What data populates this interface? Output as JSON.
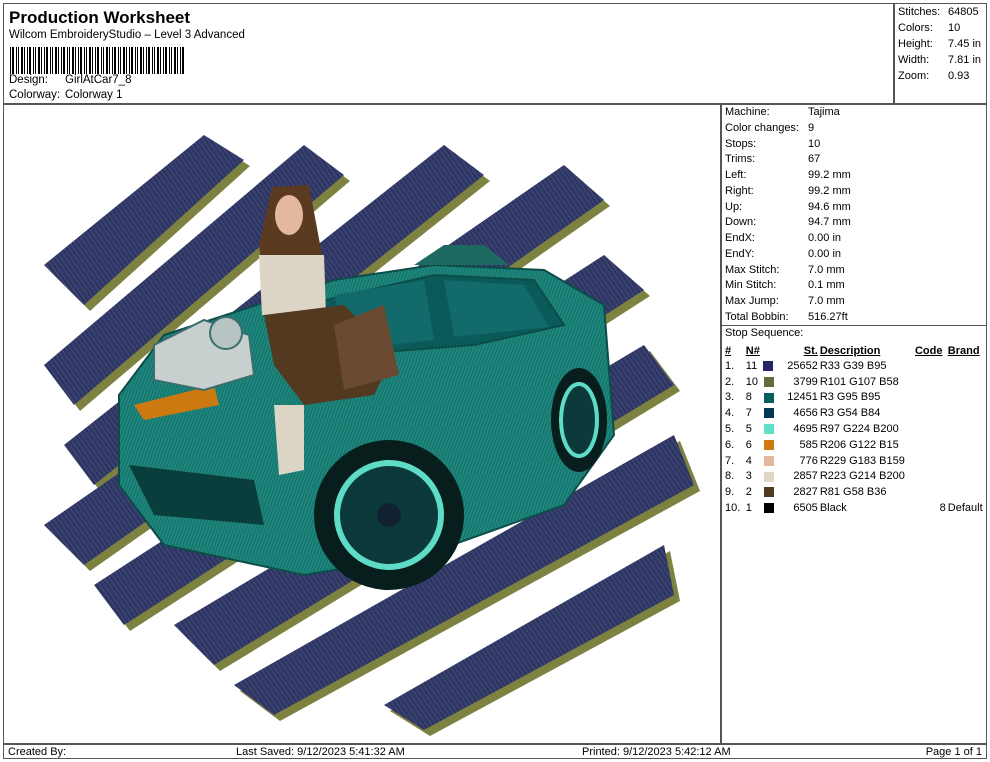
{
  "header": {
    "title": "Production Worksheet",
    "software": "Wilcom EmbroideryStudio – Level 3 Advanced",
    "design_label": "Design:",
    "design_value": "GirlAtCar7_8",
    "colorway_label": "Colorway:",
    "colorway_value": "Colorway 1"
  },
  "summary": [
    {
      "label": "Stitches:",
      "value": "64805"
    },
    {
      "label": "Colors:",
      "value": "10"
    },
    {
      "label": "Height:",
      "value": "7.45 in"
    },
    {
      "label": "Width:",
      "value": "7.81 in"
    },
    {
      "label": "Zoom:",
      "value": "0.93"
    }
  ],
  "details": [
    {
      "label": "Machine:",
      "value": "Tajima"
    },
    {
      "label": "Color changes:",
      "value": "9"
    },
    {
      "label": "Stops:",
      "value": "10"
    },
    {
      "label": "Trims:",
      "value": "67"
    },
    {
      "label": "Left:",
      "value": "99.2 mm"
    },
    {
      "label": "Right:",
      "value": "99.2 mm"
    },
    {
      "label": "Up:",
      "value": "94.6 mm"
    },
    {
      "label": "Down:",
      "value": "94.7 mm"
    },
    {
      "label": "EndX:",
      "value": "0.00 in"
    },
    {
      "label": "EndY:",
      "value": "0.00 in"
    },
    {
      "label": "Max Stitch:",
      "value": "7.0 mm"
    },
    {
      "label": "Min Stitch:",
      "value": "0.1 mm"
    },
    {
      "label": "Max Jump:",
      "value": "7.0 mm"
    },
    {
      "label": "Total Bobbin:",
      "value": "516.27ft"
    }
  ],
  "stop_sequence": {
    "title": "Stop Sequence:",
    "headers": [
      "#",
      "N#",
      "St.",
      "Description",
      "Code",
      "Brand"
    ],
    "rows": [
      {
        "idx": "1.",
        "n": "11",
        "color": "#21275F",
        "st": "25652",
        "desc": "R33 G39 B95",
        "code": "",
        "brand": ""
      },
      {
        "idx": "2.",
        "n": "10",
        "color": "#656B3A",
        "st": "3799",
        "desc": "R101 G107 B58",
        "code": "",
        "brand": ""
      },
      {
        "idx": "3.",
        "n": "8",
        "color": "#035F5F",
        "st": "12451",
        "desc": "R3 G95 B95",
        "code": "",
        "brand": ""
      },
      {
        "idx": "4.",
        "n": "7",
        "color": "#033654",
        "st": "4656",
        "desc": "R3 G54 B84",
        "code": "",
        "brand": ""
      },
      {
        "idx": "5.",
        "n": "5",
        "color": "#61E0C8",
        "st": "4695",
        "desc": "R97 G224 B200",
        "code": "",
        "brand": ""
      },
      {
        "idx": "6.",
        "n": "6",
        "color": "#CE7A0F",
        "st": "585",
        "desc": "R206 G122 B15",
        "code": "",
        "brand": ""
      },
      {
        "idx": "7.",
        "n": "4",
        "color": "#E5B79F",
        "st": "776",
        "desc": "R229 G183 B159",
        "code": "",
        "brand": ""
      },
      {
        "idx": "8.",
        "n": "3",
        "color": "#DFD6C8",
        "st": "2857",
        "desc": "R223 G214 B200",
        "code": "",
        "brand": ""
      },
      {
        "idx": "9.",
        "n": "2",
        "color": "#513A24",
        "st": "2827",
        "desc": "R81 G58 B36",
        "code": "",
        "brand": ""
      },
      {
        "idx": "10.",
        "n": "1",
        "color": "#000000",
        "st": "6505",
        "desc": "Black",
        "code": "8",
        "brand": "Default"
      }
    ]
  },
  "footer": {
    "created_by": "Created By:",
    "last_saved": "Last Saved: 9/12/2023 5:41:32 AM",
    "printed": "Printed: 9/12/2023 5:42:12 AM",
    "page": "Page 1 of 1"
  }
}
